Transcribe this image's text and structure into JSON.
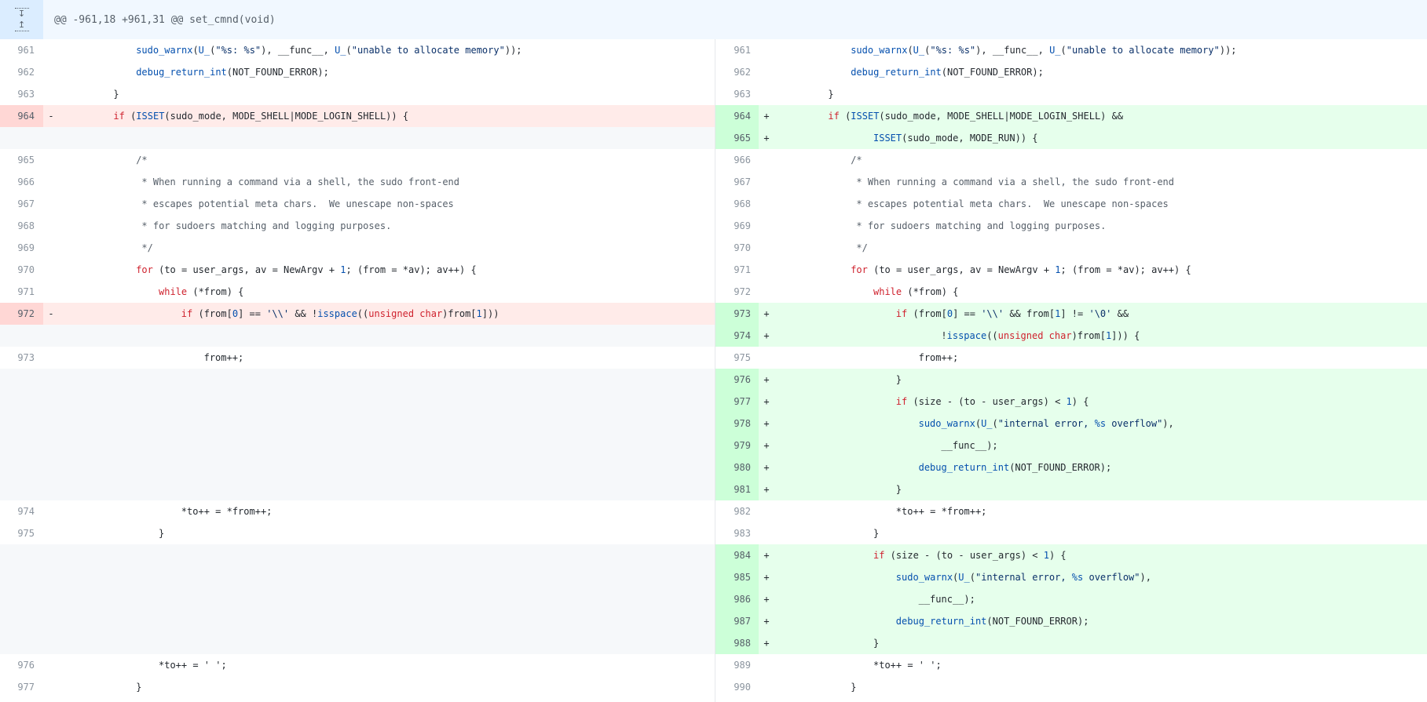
{
  "hunk_header": "@@ -961,18 +961,31 @@ set_cmnd(void)",
  "expand_icon": "expand-up-down-icon",
  "colors": {
    "added_bg": "#e6ffec",
    "added_gutter": "#ccffd8",
    "removed_bg": "#ffebe9",
    "removed_gutter": "#ffd7d5",
    "hunk_bg": "#f1f8ff",
    "expander_bg": "#dbedff",
    "empty_bg": "#f6f8fa"
  },
  "left": [
    {
      "type": "ctx",
      "num": "961",
      "marker": "",
      "indent": 16,
      "tokens": [
        [
          "fn",
          "sudo_warnx"
        ],
        [
          "",
          "("
        ],
        [
          "fn",
          "U_"
        ],
        [
          "",
          "("
        ],
        [
          "str",
          "\"%s: %s\""
        ],
        [
          "",
          "), __func__, "
        ],
        [
          "fn",
          "U_"
        ],
        [
          "",
          "("
        ],
        [
          "str",
          "\"unable to allocate memory\""
        ],
        [
          "",
          "));"
        ]
      ]
    },
    {
      "type": "ctx",
      "num": "962",
      "marker": "",
      "indent": 16,
      "tokens": [
        [
          "fn",
          "debug_return_int"
        ],
        [
          "",
          "(NOT_FOUND_ERROR);"
        ]
      ]
    },
    {
      "type": "ctx",
      "num": "963",
      "marker": "",
      "indent": 12,
      "tokens": [
        [
          "",
          "}"
        ]
      ]
    },
    {
      "type": "del",
      "num": "964",
      "marker": "-",
      "indent": 12,
      "tokens": [
        [
          "kw",
          "if"
        ],
        [
          "",
          " ("
        ],
        [
          "fn",
          "ISSET"
        ],
        [
          "",
          "(sudo_mode, MODE_SHELL|MODE_LOGIN_SHELL)) {"
        ]
      ]
    },
    {
      "type": "empty",
      "num": "",
      "marker": "",
      "indent": 0,
      "tokens": []
    },
    {
      "type": "ctx",
      "num": "965",
      "marker": "",
      "indent": 16,
      "tokens": [
        [
          "cm",
          "/*"
        ]
      ]
    },
    {
      "type": "ctx",
      "num": "966",
      "marker": "",
      "indent": 16,
      "tokens": [
        [
          "cm",
          " * When running a command via a shell, the sudo front-end"
        ]
      ]
    },
    {
      "type": "ctx",
      "num": "967",
      "marker": "",
      "indent": 16,
      "tokens": [
        [
          "cm",
          " * escapes potential meta chars.  We unescape non-spaces"
        ]
      ]
    },
    {
      "type": "ctx",
      "num": "968",
      "marker": "",
      "indent": 16,
      "tokens": [
        [
          "cm",
          " * for sudoers matching and logging purposes."
        ]
      ]
    },
    {
      "type": "ctx",
      "num": "969",
      "marker": "",
      "indent": 16,
      "tokens": [
        [
          "cm",
          " */"
        ]
      ]
    },
    {
      "type": "ctx",
      "num": "970",
      "marker": "",
      "indent": 16,
      "tokens": [
        [
          "kw",
          "for"
        ],
        [
          "",
          " (to = user_args, av = NewArgv + "
        ],
        [
          "num",
          "1"
        ],
        [
          "",
          "; (from = *av); av++) {"
        ]
      ]
    },
    {
      "type": "ctx",
      "num": "971",
      "marker": "",
      "indent": 20,
      "tokens": [
        [
          "kw",
          "while"
        ],
        [
          "",
          " (*from) {"
        ]
      ]
    },
    {
      "type": "del",
      "num": "972",
      "marker": "-",
      "indent": 24,
      "tokens": [
        [
          "kw",
          "if"
        ],
        [
          "",
          " (from["
        ],
        [
          "num",
          "0"
        ],
        [
          "",
          "] == "
        ],
        [
          "str",
          "'\\\\'"
        ],
        [
          "",
          " && !"
        ],
        [
          "fn",
          "isspace"
        ],
        [
          "",
          "(("
        ],
        [
          "kw",
          "unsigned char"
        ],
        [
          "",
          ")from["
        ],
        [
          "num",
          "1"
        ],
        [
          "",
          "]))"
        ]
      ]
    },
    {
      "type": "empty",
      "num": "",
      "marker": "",
      "indent": 0,
      "tokens": []
    },
    {
      "type": "ctx",
      "num": "973",
      "marker": "",
      "indent": 28,
      "tokens": [
        [
          "",
          "from++;"
        ]
      ]
    },
    {
      "type": "empty",
      "num": "",
      "marker": "",
      "indent": 0,
      "tokens": []
    },
    {
      "type": "empty",
      "num": "",
      "marker": "",
      "indent": 0,
      "tokens": []
    },
    {
      "type": "empty",
      "num": "",
      "marker": "",
      "indent": 0,
      "tokens": []
    },
    {
      "type": "empty",
      "num": "",
      "marker": "",
      "indent": 0,
      "tokens": []
    },
    {
      "type": "empty",
      "num": "",
      "marker": "",
      "indent": 0,
      "tokens": []
    },
    {
      "type": "empty",
      "num": "",
      "marker": "",
      "indent": 0,
      "tokens": []
    },
    {
      "type": "ctx",
      "num": "974",
      "marker": "",
      "indent": 24,
      "tokens": [
        [
          "",
          "*to++ = *from++;"
        ]
      ]
    },
    {
      "type": "ctx",
      "num": "975",
      "marker": "",
      "indent": 20,
      "tokens": [
        [
          "",
          "}"
        ]
      ]
    },
    {
      "type": "empty",
      "num": "",
      "marker": "",
      "indent": 0,
      "tokens": []
    },
    {
      "type": "empty",
      "num": "",
      "marker": "",
      "indent": 0,
      "tokens": []
    },
    {
      "type": "empty",
      "num": "",
      "marker": "",
      "indent": 0,
      "tokens": []
    },
    {
      "type": "empty",
      "num": "",
      "marker": "",
      "indent": 0,
      "tokens": []
    },
    {
      "type": "empty",
      "num": "",
      "marker": "",
      "indent": 0,
      "tokens": []
    },
    {
      "type": "ctx",
      "num": "976",
      "marker": "",
      "indent": 20,
      "tokens": [
        [
          "",
          "*to++ = ' ';"
        ]
      ]
    },
    {
      "type": "ctx",
      "num": "977",
      "marker": "",
      "indent": 16,
      "tokens": [
        [
          "",
          "}"
        ]
      ]
    }
  ],
  "right": [
    {
      "type": "ctx",
      "num": "961",
      "marker": "",
      "indent": 16,
      "tokens": [
        [
          "fn",
          "sudo_warnx"
        ],
        [
          "",
          "("
        ],
        [
          "fn",
          "U_"
        ],
        [
          "",
          "("
        ],
        [
          "str",
          "\"%s: %s\""
        ],
        [
          "",
          "), __func__, "
        ],
        [
          "fn",
          "U_"
        ],
        [
          "",
          "("
        ],
        [
          "str",
          "\"unable to allocate memory\""
        ],
        [
          "",
          "));"
        ]
      ]
    },
    {
      "type": "ctx",
      "num": "962",
      "marker": "",
      "indent": 16,
      "tokens": [
        [
          "fn",
          "debug_return_int"
        ],
        [
          "",
          "(NOT_FOUND_ERROR);"
        ]
      ]
    },
    {
      "type": "ctx",
      "num": "963",
      "marker": "",
      "indent": 12,
      "tokens": [
        [
          "",
          "}"
        ]
      ]
    },
    {
      "type": "add",
      "num": "964",
      "marker": "+",
      "indent": 12,
      "tokens": [
        [
          "kw",
          "if"
        ],
        [
          "",
          " ("
        ],
        [
          "fn",
          "ISSET"
        ],
        [
          "",
          "(sudo_mode, MODE_SHELL|MODE_LOGIN_SHELL) &&"
        ]
      ]
    },
    {
      "type": "add",
      "num": "965",
      "marker": "+",
      "indent": 20,
      "tokens": [
        [
          "fn",
          "ISSET"
        ],
        [
          "",
          "(sudo_mode, MODE_RUN)) {"
        ]
      ]
    },
    {
      "type": "ctx",
      "num": "966",
      "marker": "",
      "indent": 16,
      "tokens": [
        [
          "cm",
          "/*"
        ]
      ]
    },
    {
      "type": "ctx",
      "num": "967",
      "marker": "",
      "indent": 16,
      "tokens": [
        [
          "cm",
          " * When running a command via a shell, the sudo front-end"
        ]
      ]
    },
    {
      "type": "ctx",
      "num": "968",
      "marker": "",
      "indent": 16,
      "tokens": [
        [
          "cm",
          " * escapes potential meta chars.  We unescape non-spaces"
        ]
      ]
    },
    {
      "type": "ctx",
      "num": "969",
      "marker": "",
      "indent": 16,
      "tokens": [
        [
          "cm",
          " * for sudoers matching and logging purposes."
        ]
      ]
    },
    {
      "type": "ctx",
      "num": "970",
      "marker": "",
      "indent": 16,
      "tokens": [
        [
          "cm",
          " */"
        ]
      ]
    },
    {
      "type": "ctx",
      "num": "971",
      "marker": "",
      "indent": 16,
      "tokens": [
        [
          "kw",
          "for"
        ],
        [
          "",
          " (to = user_args, av = NewArgv + "
        ],
        [
          "num",
          "1"
        ],
        [
          "",
          "; (from = *av); av++) {"
        ]
      ]
    },
    {
      "type": "ctx",
      "num": "972",
      "marker": "",
      "indent": 20,
      "tokens": [
        [
          "kw",
          "while"
        ],
        [
          "",
          " (*from) {"
        ]
      ]
    },
    {
      "type": "add",
      "num": "973",
      "marker": "+",
      "indent": 24,
      "tokens": [
        [
          "kw",
          "if"
        ],
        [
          "",
          " (from["
        ],
        [
          "num",
          "0"
        ],
        [
          "",
          "] == "
        ],
        [
          "str",
          "'\\\\'"
        ],
        [
          "",
          " && from["
        ],
        [
          "num",
          "1"
        ],
        [
          "",
          "] != "
        ],
        [
          "str",
          "'\\0'"
        ],
        [
          "",
          " &&"
        ]
      ]
    },
    {
      "type": "add",
      "num": "974",
      "marker": "+",
      "indent": 32,
      "tokens": [
        [
          "",
          "!"
        ],
        [
          "fn",
          "isspace"
        ],
        [
          "",
          "(("
        ],
        [
          "kw",
          "unsigned char"
        ],
        [
          "",
          ")from["
        ],
        [
          "num",
          "1"
        ],
        [
          "",
          "])) {"
        ]
      ]
    },
    {
      "type": "ctx",
      "num": "975",
      "marker": "",
      "indent": 28,
      "tokens": [
        [
          "",
          "from++;"
        ]
      ]
    },
    {
      "type": "add",
      "num": "976",
      "marker": "+",
      "indent": 24,
      "tokens": [
        [
          "",
          "}"
        ]
      ]
    },
    {
      "type": "add",
      "num": "977",
      "marker": "+",
      "indent": 24,
      "tokens": [
        [
          "kw",
          "if"
        ],
        [
          "",
          " (size - (to - user_args) < "
        ],
        [
          "num",
          "1"
        ],
        [
          "",
          ") {"
        ]
      ]
    },
    {
      "type": "add",
      "num": "978",
      "marker": "+",
      "indent": 28,
      "tokens": [
        [
          "fn",
          "sudo_warnx"
        ],
        [
          "",
          "("
        ],
        [
          "fn",
          "U_"
        ],
        [
          "",
          "("
        ],
        [
          "str",
          "\"internal error, "
        ],
        [
          "fn",
          "%s"
        ],
        [
          "str",
          " overflow\""
        ],
        [
          "",
          "),"
        ]
      ]
    },
    {
      "type": "add",
      "num": "979",
      "marker": "+",
      "indent": 32,
      "tokens": [
        [
          "",
          "__func__);"
        ]
      ]
    },
    {
      "type": "add",
      "num": "980",
      "marker": "+",
      "indent": 28,
      "tokens": [
        [
          "fn",
          "debug_return_int"
        ],
        [
          "",
          "(NOT_FOUND_ERROR);"
        ]
      ]
    },
    {
      "type": "add",
      "num": "981",
      "marker": "+",
      "indent": 24,
      "tokens": [
        [
          "",
          "}"
        ]
      ]
    },
    {
      "type": "ctx",
      "num": "982",
      "marker": "",
      "indent": 24,
      "tokens": [
        [
          "",
          "*to++ = *from++;"
        ]
      ]
    },
    {
      "type": "ctx",
      "num": "983",
      "marker": "",
      "indent": 20,
      "tokens": [
        [
          "",
          "}"
        ]
      ]
    },
    {
      "type": "add",
      "num": "984",
      "marker": "+",
      "indent": 20,
      "tokens": [
        [
          "kw",
          "if"
        ],
        [
          "",
          " (size - (to - user_args) < "
        ],
        [
          "num",
          "1"
        ],
        [
          "",
          ") {"
        ]
      ]
    },
    {
      "type": "add",
      "num": "985",
      "marker": "+",
      "indent": 24,
      "tokens": [
        [
          "fn",
          "sudo_warnx"
        ],
        [
          "",
          "("
        ],
        [
          "fn",
          "U_"
        ],
        [
          "",
          "("
        ],
        [
          "str",
          "\"internal error, "
        ],
        [
          "fn",
          "%s"
        ],
        [
          "str",
          " overflow\""
        ],
        [
          "",
          "),"
        ]
      ]
    },
    {
      "type": "add",
      "num": "986",
      "marker": "+",
      "indent": 28,
      "tokens": [
        [
          "",
          "__func__);"
        ]
      ]
    },
    {
      "type": "add",
      "num": "987",
      "marker": "+",
      "indent": 24,
      "tokens": [
        [
          "fn",
          "debug_return_int"
        ],
        [
          "",
          "(NOT_FOUND_ERROR);"
        ]
      ]
    },
    {
      "type": "add",
      "num": "988",
      "marker": "+",
      "indent": 20,
      "tokens": [
        [
          "",
          "}"
        ]
      ]
    },
    {
      "type": "ctx",
      "num": "989",
      "marker": "",
      "indent": 20,
      "tokens": [
        [
          "",
          "*to++ = ' ';"
        ]
      ]
    },
    {
      "type": "ctx",
      "num": "990",
      "marker": "",
      "indent": 16,
      "tokens": [
        [
          "",
          "}"
        ]
      ]
    }
  ]
}
